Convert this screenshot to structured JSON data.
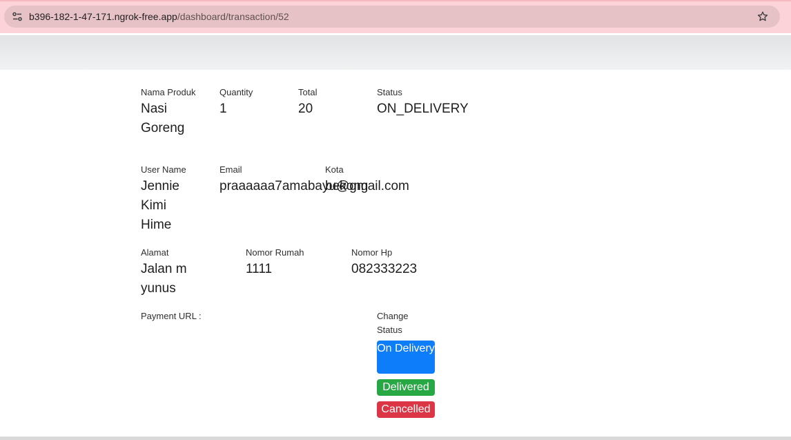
{
  "browser": {
    "url_host": "b396-182-1-47-171.ngrok-free.app",
    "url_path": "/dashboard/transaction/52"
  },
  "detail": {
    "product_label": "Nama Produk",
    "product_value": "Nasi Goreng",
    "quantity_label": "Quantity",
    "quantity_value": "1",
    "total_label": "Total",
    "total_value": "20",
    "status_label": "Status",
    "status_value": "ON_DELIVERY",
    "username_label": "User Name",
    "username_value": "Jennie Kimi Hime",
    "email_label": "Email",
    "email_value": "praaaaaa7amabayu@gmail.com",
    "city_label": "Kota",
    "city_value": "bekong",
    "address_label": "Alamat",
    "address_value": "Jalan m yunus",
    "house_number_label": "Nomor Rumah",
    "house_number_value": "1111",
    "phone_label": "Nomor Hp",
    "phone_value": "082333223",
    "payment_url_label": "Payment URL :",
    "change_status_label": "Change Status"
  },
  "actions": {
    "on_delivery": "On Delivery",
    "delivered": "Delivered",
    "cancelled": "Cancelled"
  },
  "icons": {
    "site_info": "tune-icon",
    "bookmark": "star-outline-icon"
  },
  "colors": {
    "on_delivery": "#0d7dfa",
    "delivered": "#28a745",
    "cancelled": "#dc3545"
  }
}
